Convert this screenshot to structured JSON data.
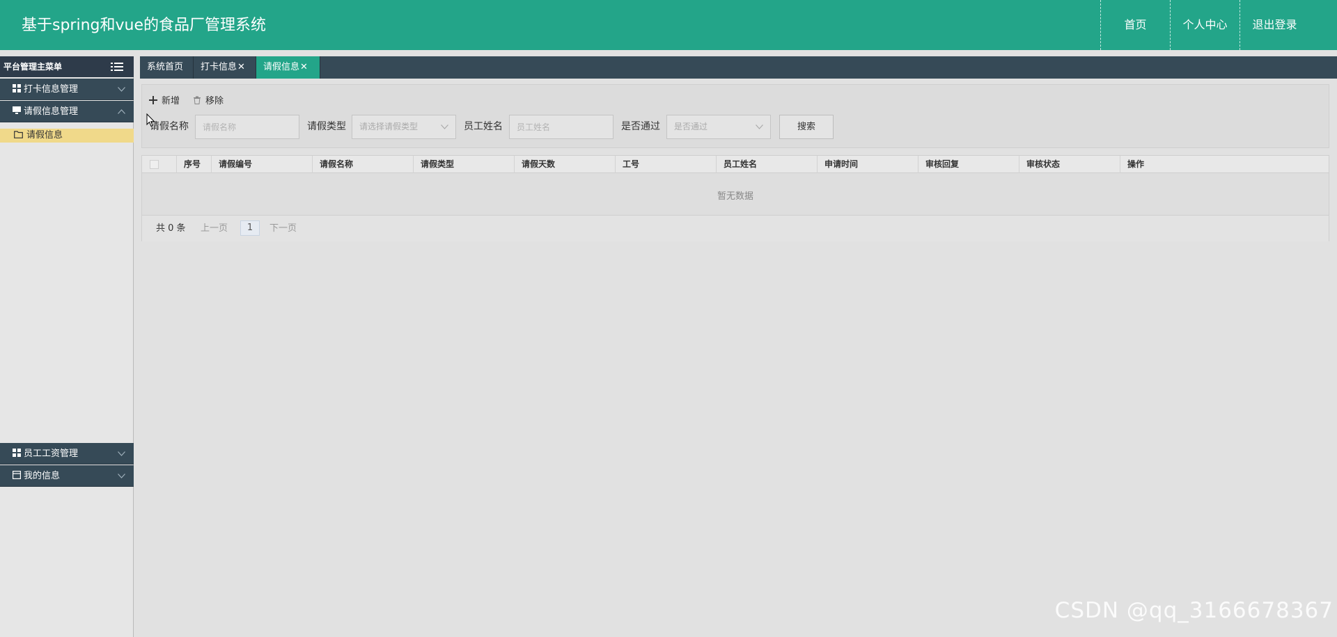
{
  "header": {
    "title": "基于spring和vue的食品厂管理系统",
    "nav": [
      {
        "label": "首页"
      },
      {
        "label": "个人中心"
      },
      {
        "label": "退出登录"
      }
    ]
  },
  "sidebar": {
    "menu_title": "平台管理主菜单",
    "groups": [
      {
        "label": "打卡信息管理",
        "icon": "grid-icon",
        "expanded": false
      },
      {
        "label": "请假信息管理",
        "icon": "monitor-icon",
        "expanded": true,
        "items": [
          {
            "label": "请假信息",
            "icon": "folder-icon",
            "active": true
          }
        ]
      },
      {
        "label": "员工工资管理",
        "icon": "grid-icon",
        "expanded": false
      },
      {
        "label": "我的信息",
        "icon": "card-icon",
        "expanded": false
      }
    ]
  },
  "tabs": [
    {
      "label": "系统首页",
      "closable": false,
      "active": false
    },
    {
      "label": "打卡信息",
      "closable": true,
      "active": false
    },
    {
      "label": "请假信息",
      "closable": true,
      "active": true
    }
  ],
  "toolbar": {
    "add_label": "新增",
    "remove_label": "移除",
    "search_label": "搜索",
    "filters": {
      "leave_name": {
        "label": "请假名称",
        "placeholder": "请假名称"
      },
      "leave_type": {
        "label": "请假类型",
        "placeholder": "请选择请假类型"
      },
      "employee_name": {
        "label": "员工姓名",
        "placeholder": "员工姓名"
      },
      "approved": {
        "label": "是否通过",
        "placeholder": "是否通过"
      }
    }
  },
  "table": {
    "columns": [
      "序号",
      "请假编号",
      "请假名称",
      "请假类型",
      "请假天数",
      "工号",
      "员工姓名",
      "申请时间",
      "审核回复",
      "审核状态",
      "操作"
    ],
    "rows": [],
    "empty_text": "暂无数据"
  },
  "pagination": {
    "total_text": "共 0 条",
    "prev_label": "上一页",
    "current_page": "1",
    "next_label": "下一页"
  },
  "watermark": "CSDN @qq_3166678367",
  "colors": {
    "header_bg": "#23a589",
    "sidebar_dark": "#364a57",
    "active_item": "#f0d98a"
  }
}
